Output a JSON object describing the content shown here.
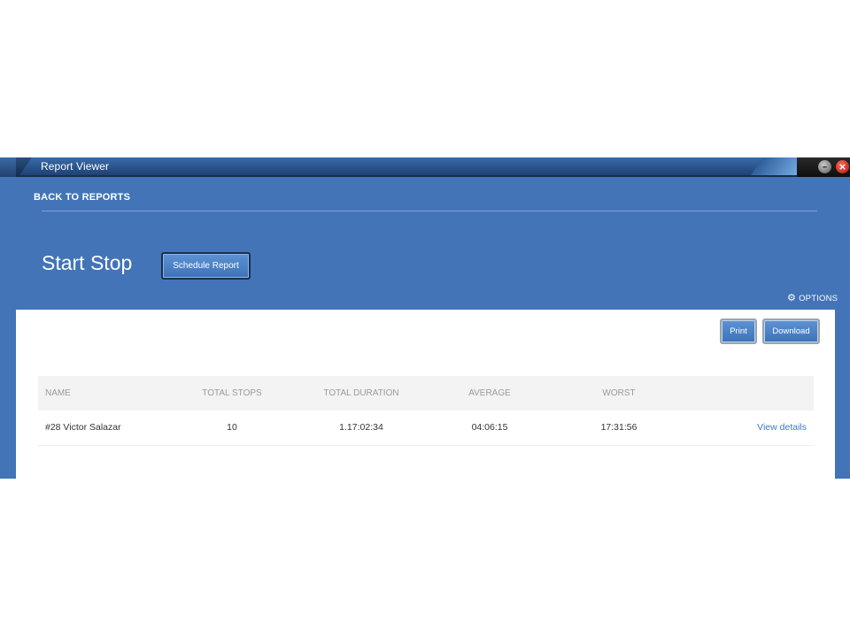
{
  "window": {
    "title": "Report Viewer",
    "minimize_glyph": "–",
    "close_glyph": "×"
  },
  "nav": {
    "back_label": "BACK TO REPORTS"
  },
  "header": {
    "page_title": "Start Stop",
    "schedule_button": "Schedule Report",
    "options_label": "OPTIONS",
    "options_icon": "gear-icon"
  },
  "toolbar": {
    "print_label": "Print",
    "download_label": "Download"
  },
  "table": {
    "columns": [
      "NAME",
      "TOTAL STOPS",
      "TOTAL DURATION",
      "AVERAGE",
      "WORST"
    ],
    "rows": [
      {
        "name": "#28 Victor Salazar",
        "total_stops": "10",
        "total_duration": "1.17:02:34",
        "average": "04:06:15",
        "worst": "17:31:56",
        "action": "View details"
      }
    ]
  },
  "colors": {
    "window_blue": "#4274b7",
    "button_blue": "#4a82c8",
    "link_blue": "#3d78c9",
    "header_row_bg": "#f3f3f3"
  }
}
